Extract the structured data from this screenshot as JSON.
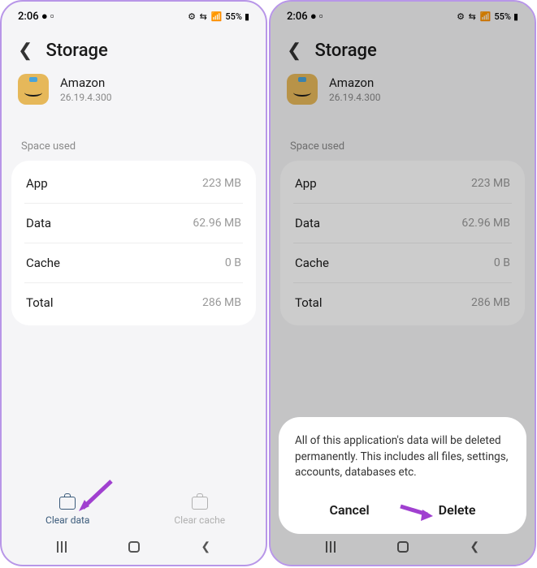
{
  "statusBar": {
    "time": "2:06",
    "battery": "55%"
  },
  "header": {
    "title": "Storage"
  },
  "app": {
    "name": "Amazon",
    "version": "26.19.4.300"
  },
  "section": {
    "label": "Space used"
  },
  "rows": [
    {
      "label": "App",
      "value": "223 MB"
    },
    {
      "label": "Data",
      "value": "62.96 MB"
    },
    {
      "label": "Cache",
      "value": "0 B"
    },
    {
      "label": "Total",
      "value": "286 MB"
    }
  ],
  "actions": {
    "clearData": "Clear data",
    "clearCache": "Clear cache"
  },
  "dialog": {
    "text": "All of this application's data will be deleted permanently. This includes all files, settings, accounts, databases etc.",
    "cancel": "Cancel",
    "delete": "Delete"
  }
}
